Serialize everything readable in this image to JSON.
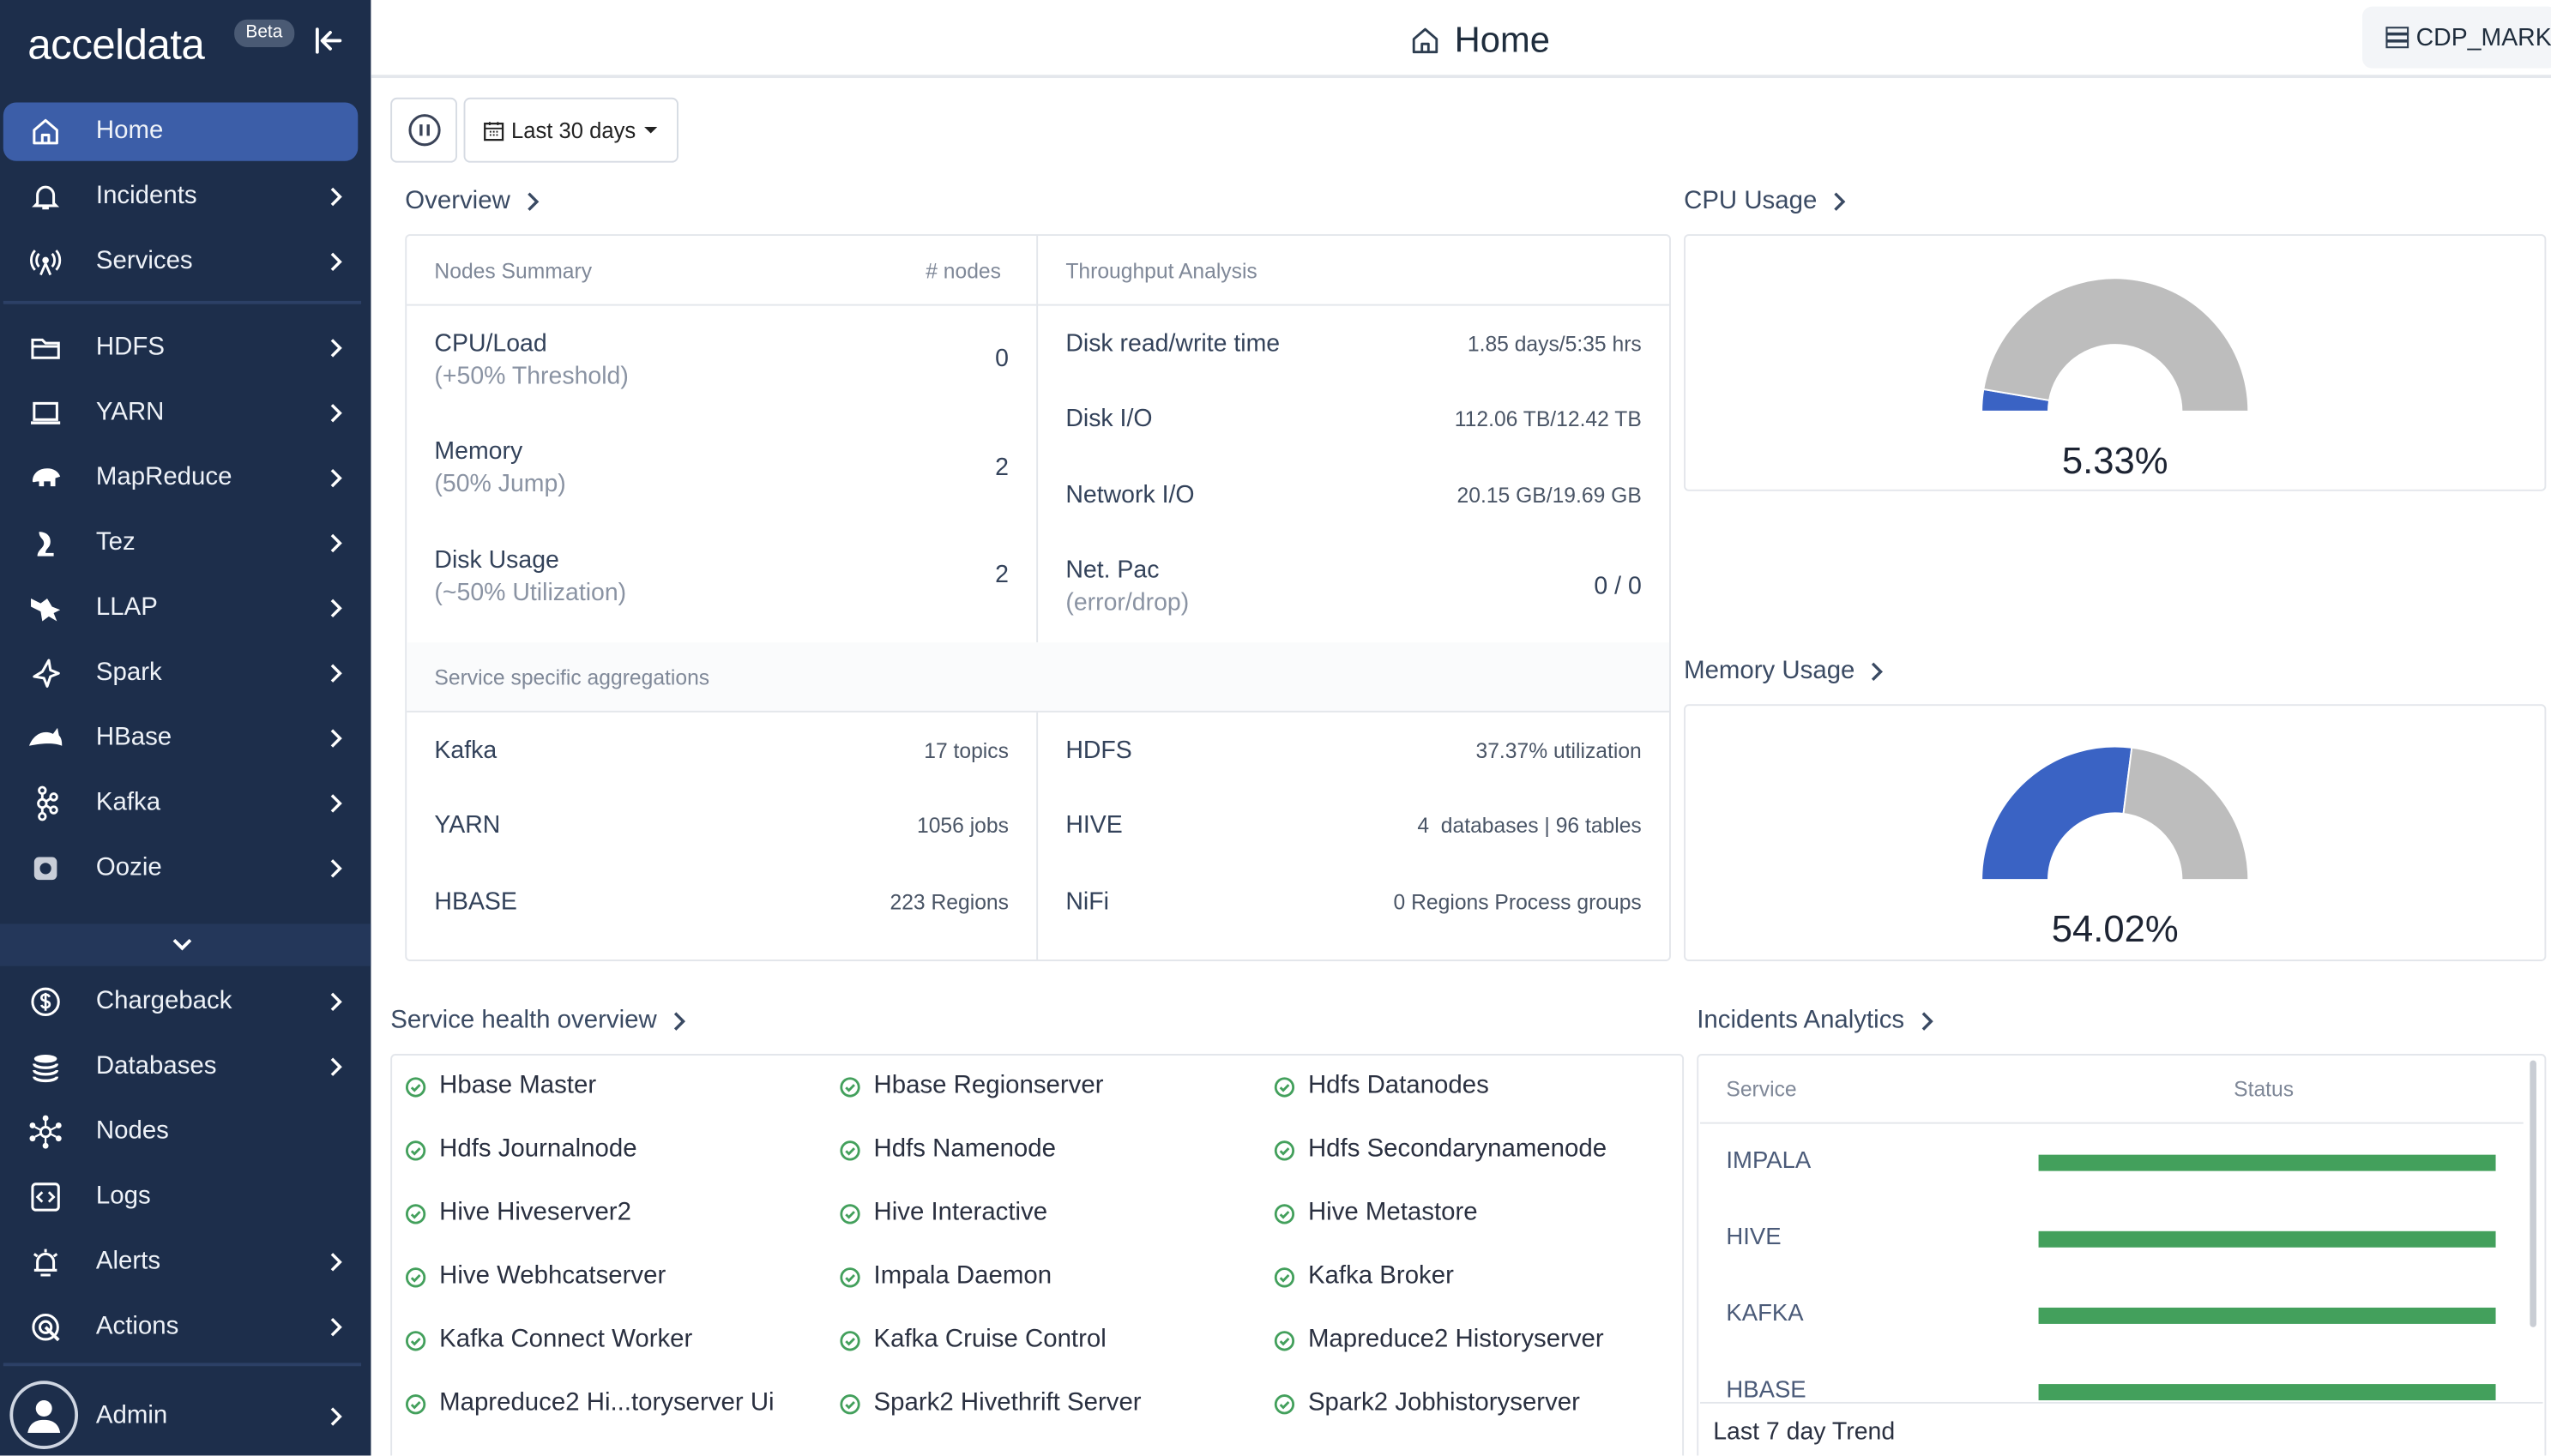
{
  "brand": {
    "name": "acceldata",
    "badge": "Beta"
  },
  "sidebar": {
    "items": [
      {
        "label": "Home",
        "icon": "home-icon"
      },
      {
        "label": "Incidents",
        "icon": "bell-icon"
      },
      {
        "label": "Services",
        "icon": "broadcast-icon"
      },
      {
        "label": "HDFS",
        "icon": "folder-icon"
      },
      {
        "label": "YARN",
        "icon": "laptop-icon"
      },
      {
        "label": "MapReduce",
        "icon": "elephant-icon"
      },
      {
        "label": "Tez",
        "icon": "tez-icon"
      },
      {
        "label": "LLAP",
        "icon": "bee-icon"
      },
      {
        "label": "Spark",
        "icon": "spark-icon"
      },
      {
        "label": "HBase",
        "icon": "orca-icon"
      },
      {
        "label": "Kafka",
        "icon": "kafka-icon"
      },
      {
        "label": "Oozie",
        "icon": "oozie-icon"
      },
      {
        "label": "Chargeback",
        "icon": "dollar-icon"
      },
      {
        "label": "Databases",
        "icon": "database-icon"
      },
      {
        "label": "Nodes",
        "icon": "nodes-icon"
      },
      {
        "label": "Logs",
        "icon": "code-icon"
      },
      {
        "label": "Alerts",
        "icon": "alarm-icon"
      },
      {
        "label": "Actions",
        "icon": "target-icon"
      }
    ],
    "user": "Admin"
  },
  "header": {
    "title": "Home",
    "cluster": "CDP_MARK"
  },
  "toolbar": {
    "range": "Last 30 days"
  },
  "overview": {
    "title": "Overview",
    "nodes_head": "Nodes Summary",
    "nodes_count_head": "# nodes",
    "throughput_head": "Throughput Analysis",
    "nodes": [
      {
        "label": "CPU/Load",
        "sub": "(+50% Threshold)",
        "value": "0"
      },
      {
        "label": "Memory",
        "sub": "(50% Jump)",
        "value": "2"
      },
      {
        "label": "Disk Usage",
        "sub": "(~50% Utilization)",
        "value": "2"
      }
    ],
    "throughput": [
      {
        "label": "Disk read/write time",
        "value": "1.85 days/5:35 hrs"
      },
      {
        "label": "Disk I/O",
        "value": "112.06 TB/12.42 TB"
      },
      {
        "label": "Network I/O",
        "value": "20.15 GB/19.69 GB"
      },
      {
        "label": "Net. Pac",
        "sub": "(error/drop)",
        "value": "0 / 0"
      }
    ],
    "agg_head": "Service specific aggregations",
    "agg_left": [
      {
        "label": "Kafka",
        "value": "17 topics"
      },
      {
        "label": "YARN",
        "value": "1056 jobs"
      },
      {
        "label": "HBASE",
        "value": "223 Regions"
      }
    ],
    "agg_right": [
      {
        "label": "HDFS",
        "value": "37.37% utilization"
      },
      {
        "label": "HIVE",
        "value": "4  databases | 96 tables"
      },
      {
        "label": "NiFi",
        "value": "0 Regions Process groups"
      }
    ]
  },
  "cpu": {
    "title": "CPU Usage",
    "value": "5.33%",
    "fraction": 0.0533
  },
  "memory": {
    "title": "Memory Usage",
    "value": "54.02%",
    "fraction": 0.5402
  },
  "health": {
    "title": "Service health overview",
    "items": [
      "Hbase Master",
      "Hbase Regionserver",
      "Hdfs Datanodes",
      "Hdfs Journalnode",
      "Hdfs Namenode",
      "Hdfs Secondarynamenode",
      "Hive Hiveserver2",
      "Hive Interactive",
      "Hive Metastore",
      "Hive Webhcatserver",
      "Impala Daemon",
      "Kafka Broker",
      "Kafka Connect Worker",
      "Kafka Cruise Control",
      "Mapreduce2 Historyserver",
      "Mapreduce2 Hi...toryserver Ui",
      "Spark2 Hivethrift Server",
      "Spark2 Jobhistoryserver"
    ]
  },
  "incidents": {
    "title": "Incidents Analytics",
    "col_service": "Service",
    "col_status": "Status",
    "rows": [
      "IMPALA",
      "HIVE",
      "KAFKA",
      "HBASE"
    ],
    "footer": "Last 7 day Trend"
  },
  "colors": {
    "sidebar": "#1d2e4b",
    "active": "#3c5ea8",
    "gauge_fill": "#3a63c4",
    "gauge_rest": "#bdbdbd",
    "healthy": "#43a05c"
  }
}
